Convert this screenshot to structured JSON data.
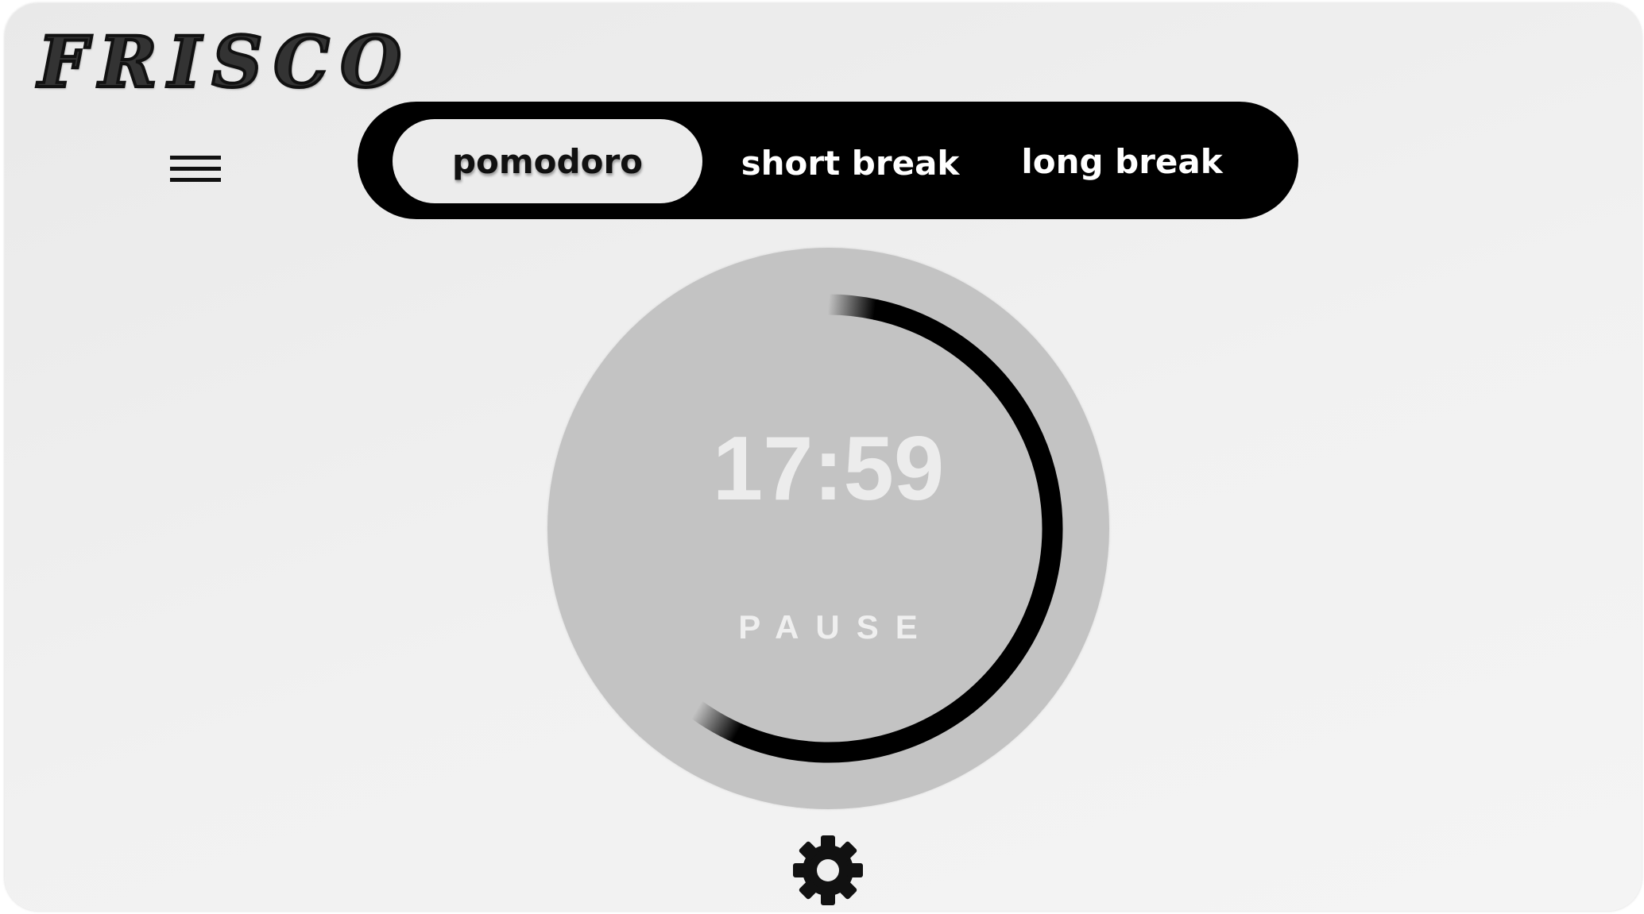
{
  "app": {
    "brand": "FRISCO"
  },
  "header": {
    "menu_icon": "hamburger-menu-icon"
  },
  "tabs": [
    {
      "label": "pomodoro",
      "active": true
    },
    {
      "label": "short break",
      "active": false
    },
    {
      "label": "long break",
      "active": false
    }
  ],
  "timer": {
    "time": "17:59",
    "action_label": "PAUSE",
    "progress_fraction": 0.6
  },
  "footer": {
    "settings_icon": "gear-icon"
  },
  "colors": {
    "background": "#efefef",
    "tab_bar": "#000000",
    "active_tab": "#ececec",
    "timer_face": "#c3c3c3",
    "progress_ring": "#000000",
    "timer_text": "#ececec"
  }
}
